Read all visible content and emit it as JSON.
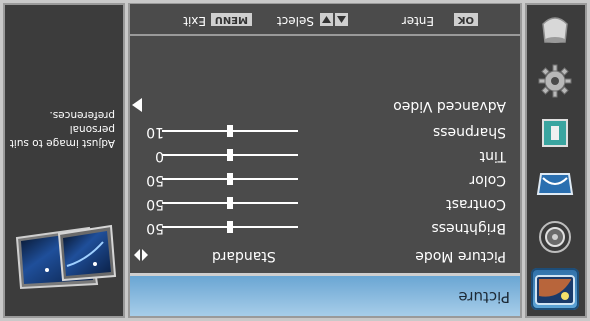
{
  "menu": {
    "icons": [
      {
        "name": "picture-icon",
        "active": true
      },
      {
        "name": "audio-icon",
        "active": false
      },
      {
        "name": "channel-icon",
        "active": false
      },
      {
        "name": "lock-icon",
        "active": false
      },
      {
        "name": "setup-icon",
        "active": false
      },
      {
        "name": "input-icon",
        "active": false
      }
    ]
  },
  "main": {
    "title": "Picture",
    "picture_mode": {
      "label": "Picture Mode",
      "value": "Standard"
    },
    "sliders": [
      {
        "label": "Brightness",
        "value": "50",
        "level": 0.5
      },
      {
        "label": "Contrast",
        "value": "50",
        "level": 0.5
      },
      {
        "label": "Color",
        "value": "50",
        "level": 0.5
      },
      {
        "label": "Tint",
        "value": "0",
        "level": 0.5
      },
      {
        "label": "Sharpness",
        "value": "10",
        "level": 0.5
      }
    ],
    "advanced_video": {
      "label": "Advanced Video"
    }
  },
  "help_bar": {
    "ok_key": "OK",
    "enter": "Enter",
    "select": "Select",
    "menu_key": "MENU",
    "exit": "Exit"
  },
  "description": {
    "text": "Adjust image to suit personal preferences."
  },
  "colors": {
    "panel": "#4b4b4b",
    "title_bar": "#8fbfe2",
    "text": "#ffffff"
  }
}
